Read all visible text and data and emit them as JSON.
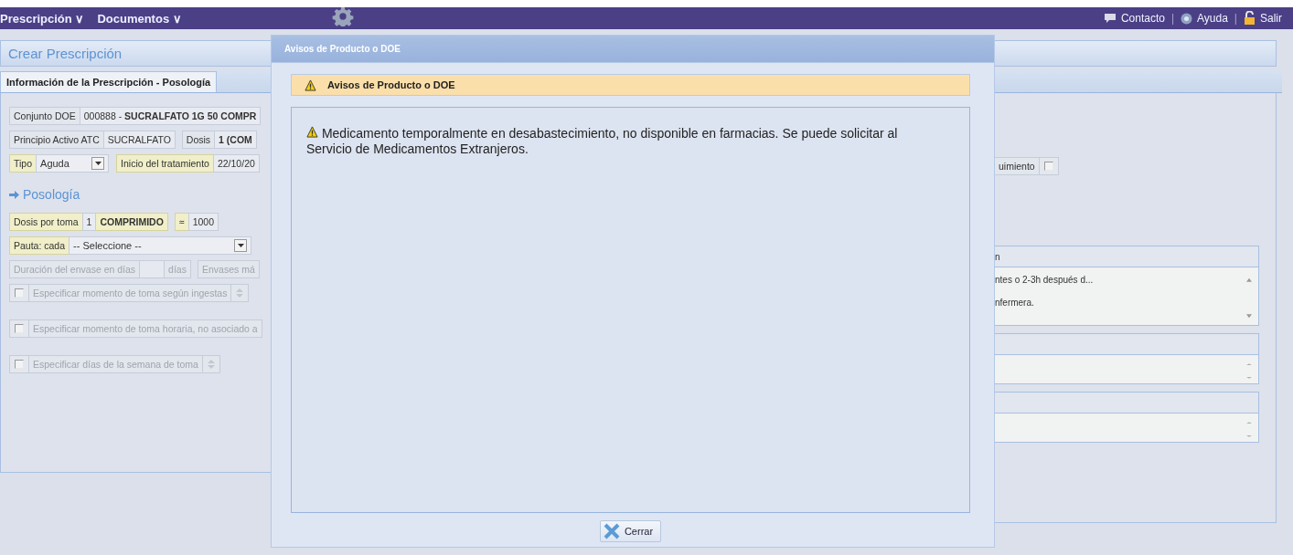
{
  "top_bar": {
    "menus": [
      {
        "label": "Prescripción",
        "caret": "∨"
      },
      {
        "label": "Documentos",
        "caret": "∨"
      }
    ],
    "links": [
      {
        "label": "Contacto"
      },
      {
        "label": "Ayuda"
      },
      {
        "label": "Salir"
      }
    ],
    "separator": "|"
  },
  "page_header": {
    "title": "Crear Prescripción"
  },
  "tabs": [
    {
      "label": "Información de la Prescripción - Posología",
      "selected": true
    }
  ],
  "form": {
    "general_rows": [
      {
        "groups": [
          [
            {
              "kind": "label",
              "text": "Conjunto DOE"
            },
            {
              "kind": "value",
              "text": "000888 - **SUCRALFATO 1G 50 COMPR**"
            }
          ]
        ]
      },
      {
        "groups": [
          [
            {
              "kind": "label",
              "text": "Principio Activo ATC"
            },
            {
              "kind": "value",
              "text": "SUCRALFATO"
            }
          ],
          [
            {
              "kind": "label",
              "text": "Dosis"
            },
            {
              "kind": "value",
              "text": "1 (COM",
              "bold": true
            }
          ]
        ]
      },
      {
        "groups": [
          [
            {
              "kind": "key_label",
              "text": "Tipo"
            },
            {
              "kind": "select",
              "text": "Aguda"
            }
          ],
          [
            {
              "kind": "key_label",
              "text": "Inicio del tratamiento"
            },
            {
              "kind": "value",
              "text": "22/10/20"
            }
          ]
        ]
      }
    ],
    "section_title": "Posología",
    "posology_rows": [
      {
        "disabled": false,
        "groups": [
          [
            {
              "kind": "key_label",
              "text": "Dosis por toma"
            },
            {
              "kind": "value",
              "text": "1"
            },
            {
              "kind": "key_label",
              "text": "COMPRIMIDO",
              "bold": true
            }
          ],
          [
            {
              "kind": "key_label",
              "text": "≈"
            },
            {
              "kind": "value",
              "text": "1000"
            }
          ]
        ]
      },
      {
        "disabled": false,
        "groups": [
          [
            {
              "kind": "key_label",
              "text": "Pauta: cada"
            },
            {
              "kind": "select",
              "text": "-- Seleccione --"
            }
          ]
        ]
      },
      {
        "disabled": true,
        "groups": [
          [
            {
              "kind": "label",
              "text": "Duración del envase en días"
            },
            {
              "kind": "input"
            },
            {
              "kind": "label",
              "text": "días"
            }
          ],
          [
            {
              "kind": "label",
              "text": "Envases má"
            }
          ]
        ]
      },
      {
        "disabled": true,
        "groups": [
          [
            {
              "kind": "checkbox",
              "checked": false
            },
            {
              "kind": "label",
              "text": "Especificar momento de toma según ingestas"
            },
            {
              "kind": "spinner"
            }
          ]
        ]
      },
      {
        "disabled": true,
        "groups": [
          [
            {
              "kind": "checkbox",
              "checked": false
            },
            {
              "kind": "label",
              "text": "Especificar momento de toma horaria, no asociado a"
            }
          ]
        ]
      },
      {
        "disabled": true,
        "groups": [
          [
            {
              "kind": "checkbox",
              "checked": false
            },
            {
              "kind": "label",
              "text": "Especificar días de la semana de toma"
            },
            {
              "kind": "spinner"
            }
          ]
        ]
      }
    ]
  },
  "right_side": {
    "follow_up": {
      "label": "uimiento",
      "checked": false
    },
    "text_areas": [
      {
        "kind": "text",
        "header": "n",
        "lines": [
          "ntes o 2-3h después d...",
          "nfermera."
        ]
      },
      {
        "kind": "empty"
      },
      {
        "kind": "empty"
      }
    ]
  },
  "dialog": {
    "title": "Avisos de Producto o DOE",
    "panel_title": "Avisos de Producto o DOE",
    "message": "Medicamento temporalmente en desabastecimiento, no disponible en farmacias. Se puede solicitar al Servicio de Medicamentos Extranjeros.",
    "button": "Cerrar"
  }
}
